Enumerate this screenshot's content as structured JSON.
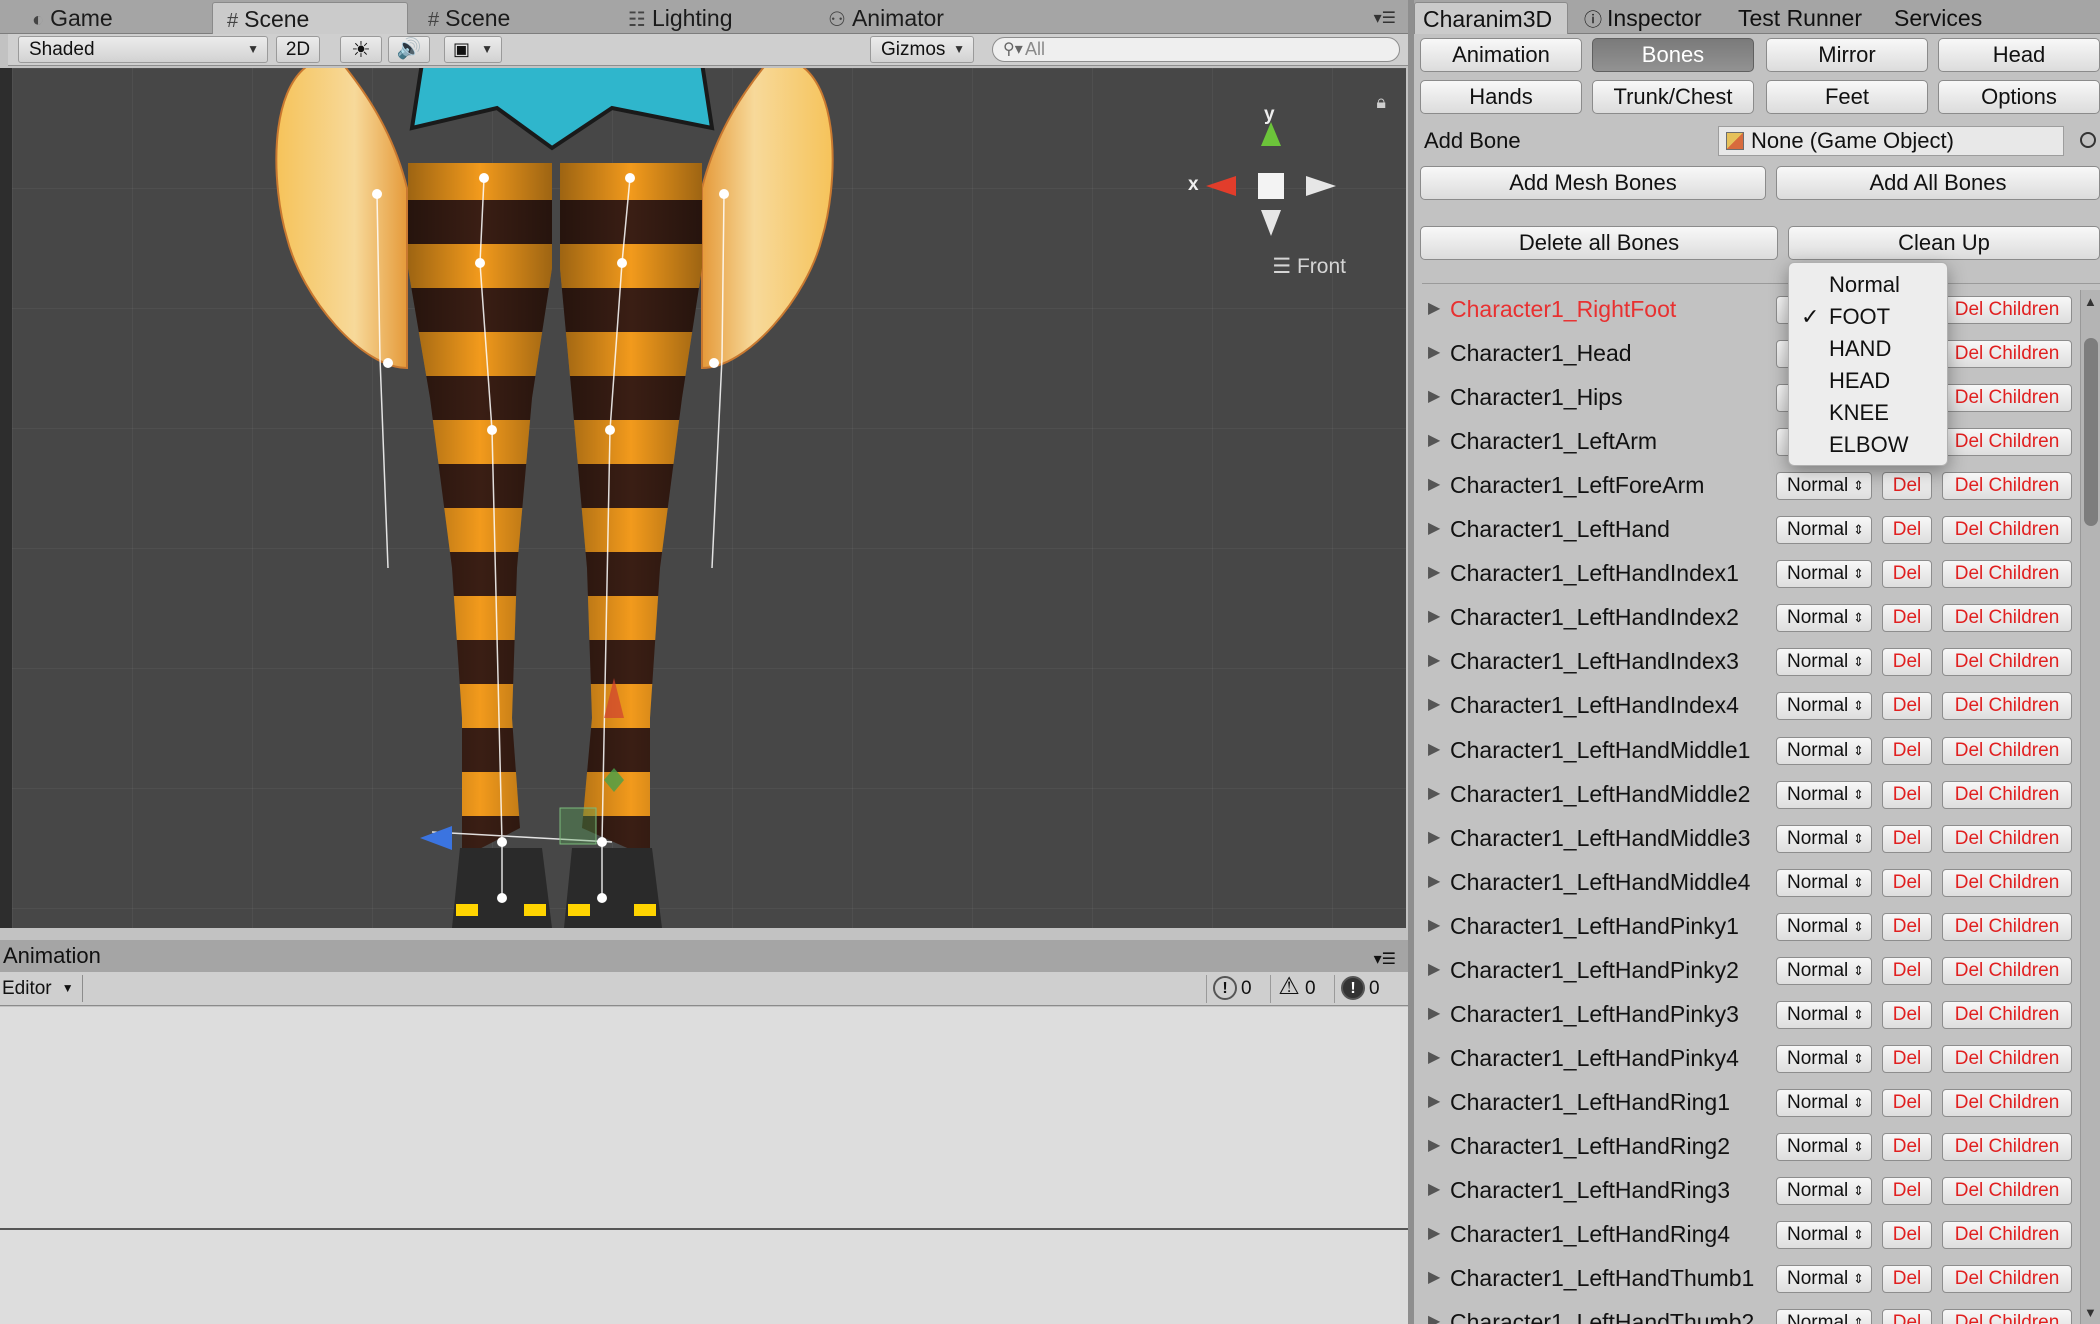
{
  "scene_window": {
    "tabs": [
      {
        "label": "Game",
        "icon": "game-controller-icon"
      },
      {
        "label": "Scene",
        "icon": "grid-icon",
        "active": true
      },
      {
        "label": "Scene",
        "icon": "grid-icon"
      },
      {
        "label": "Lighting",
        "icon": "lighting-icon"
      },
      {
        "label": "Animator",
        "icon": "animator-icon"
      }
    ],
    "toolbar": {
      "shading": "Shaded",
      "mode_2d": "2D",
      "gizmos": "Gizmos",
      "search_placeholder": "All"
    },
    "gizmo": {
      "y_label": "y",
      "x_label": "x",
      "view": "Front"
    }
  },
  "animation_window": {
    "title": "Animation",
    "editor_label": "Editor",
    "counts": {
      "info": "0",
      "warning": "0",
      "error": "0"
    }
  },
  "inspector_window": {
    "tabs": [
      "Charanim3D",
      "Inspector",
      "Test Runner",
      "Services"
    ],
    "mode_buttons": [
      {
        "label": "Animation"
      },
      {
        "label": "Bones",
        "selected": true
      },
      {
        "label": "Mirror"
      },
      {
        "label": "Head"
      },
      {
        "label": "Hands"
      },
      {
        "label": "Trunk/Chest"
      },
      {
        "label": "Feet"
      },
      {
        "label": "Options"
      }
    ],
    "add_bone_label": "Add Bone",
    "add_bone_value": "None (Game Object)",
    "add_mesh_bones": "Add Mesh Bones",
    "add_all_bones": "Add All Bones",
    "delete_all_bones": "Delete all Bones",
    "clean_up": "Clean Up",
    "del_label": "Del",
    "del_children_label": "Del Children",
    "bones": [
      {
        "name": "Character1_RightFoot",
        "type": "Normal",
        "highlight": true
      },
      {
        "name": "Character1_Head",
        "type": "Normal"
      },
      {
        "name": "Character1_Hips",
        "type": "Normal"
      },
      {
        "name": "Character1_LeftArm",
        "type": "Normal"
      },
      {
        "name": "Character1_LeftForeArm",
        "type": "Normal"
      },
      {
        "name": "Character1_LeftHand",
        "type": "Normal"
      },
      {
        "name": "Character1_LeftHandIndex1",
        "type": "Normal"
      },
      {
        "name": "Character1_LeftHandIndex2",
        "type": "Normal"
      },
      {
        "name": "Character1_LeftHandIndex3",
        "type": "Normal"
      },
      {
        "name": "Character1_LeftHandIndex4",
        "type": "Normal"
      },
      {
        "name": "Character1_LeftHandMiddle1",
        "type": "Normal"
      },
      {
        "name": "Character1_LeftHandMiddle2",
        "type": "Normal"
      },
      {
        "name": "Character1_LeftHandMiddle3",
        "type": "Normal"
      },
      {
        "name": "Character1_LeftHandMiddle4",
        "type": "Normal"
      },
      {
        "name": "Character1_LeftHandPinky1",
        "type": "Normal"
      },
      {
        "name": "Character1_LeftHandPinky2",
        "type": "Normal"
      },
      {
        "name": "Character1_LeftHandPinky3",
        "type": "Normal"
      },
      {
        "name": "Character1_LeftHandPinky4",
        "type": "Normal"
      },
      {
        "name": "Character1_LeftHandRing1",
        "type": "Normal"
      },
      {
        "name": "Character1_LeftHandRing2",
        "type": "Normal"
      },
      {
        "name": "Character1_LeftHandRing3",
        "type": "Normal"
      },
      {
        "name": "Character1_LeftHandRing4",
        "type": "Normal"
      },
      {
        "name": "Character1_LeftHandThumb1",
        "type": "Normal"
      },
      {
        "name": "Character1_LeftHandThumb2",
        "type": "Normal"
      }
    ],
    "type_dropdown": {
      "options": [
        "Normal",
        "FOOT",
        "HAND",
        "HEAD",
        "KNEE",
        "ELBOW"
      ],
      "checked": "FOOT"
    }
  }
}
